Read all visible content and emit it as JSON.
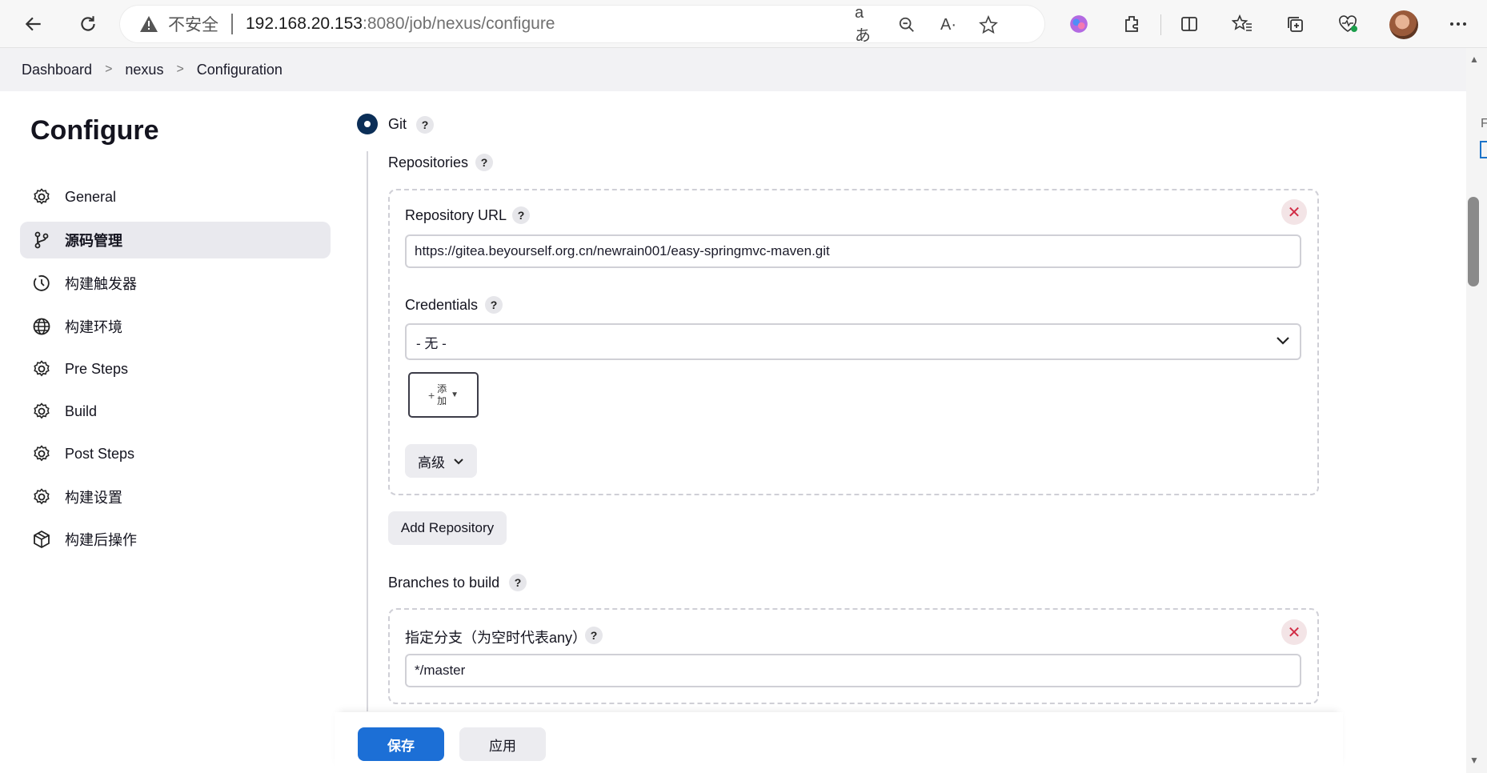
{
  "browser": {
    "insecure_label": "不安全",
    "url_host": "192.168.20.153",
    "url_rest": ":8080/job/nexus/configure",
    "read_aloud_glyph": "aあ",
    "read_glyph": "A·"
  },
  "breadcrumb": {
    "items": [
      "Dashboard",
      "nexus",
      "Configuration"
    ],
    "separator": ">"
  },
  "sidebar": {
    "title": "Configure",
    "items": [
      {
        "label": "General",
        "icon": "gear-icon"
      },
      {
        "label": "源码管理",
        "icon": "branch-icon",
        "active": true
      },
      {
        "label": "构建触发器",
        "icon": "clock-icon"
      },
      {
        "label": "构建环境",
        "icon": "globe-icon"
      },
      {
        "label": "Pre Steps",
        "icon": "gear-icon"
      },
      {
        "label": "Build",
        "icon": "gear-icon"
      },
      {
        "label": "Post Steps",
        "icon": "gear-icon"
      },
      {
        "label": "构建设置",
        "icon": "gear-icon"
      },
      {
        "label": "构建后操作",
        "icon": "package-icon"
      }
    ]
  },
  "scm": {
    "git_label": "Git",
    "help_glyph": "?",
    "repositories_label": "Repositories",
    "repository_url_label": "Repository URL",
    "repository_url_value": "https://gitea.beyourself.org.cn/newrain001/easy-springmvc-maven.git",
    "credentials_label": "Credentials",
    "credentials_value": "- 无 -",
    "add_button_label": "添加",
    "advanced_label": "高级",
    "add_repository_label": "Add Repository",
    "branches_label": "Branches to build",
    "branch_specifier_label": "指定分支（为空时代表any）",
    "branch_specifier_value": "*/master"
  },
  "actions": {
    "save_label": "保存",
    "apply_label": "应用"
  },
  "right_fragment_text": "F",
  "colors": {
    "primary": "#1c6fd6",
    "radio": "#0b2e57",
    "close": "#d12c45"
  }
}
